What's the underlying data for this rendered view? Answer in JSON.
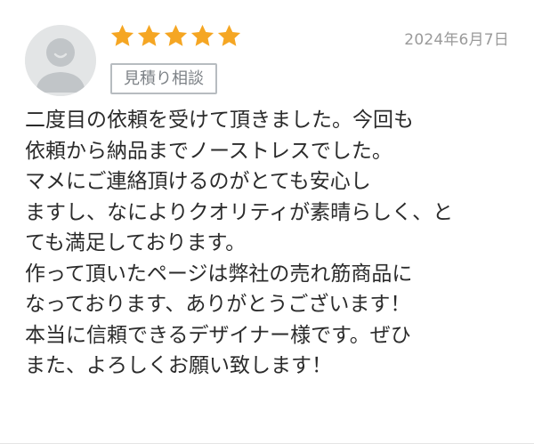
{
  "review": {
    "avatar_icon": "default-user-avatar-icon",
    "rating": {
      "value": 5,
      "max": 5,
      "icon": "star-icon",
      "color": "#f5a623"
    },
    "date": "2024年6月7日",
    "tag": "見積り相談",
    "body_lines": [
      "二度目の依頼を受けて頂きました。今回も",
      "依頼から納品までノーストレスでした。",
      "マメにご連絡頂けるのがとても安心しますし、なによりクオリティが素晴らしく、と",
      "ても満足しております。",
      "作って頂いたページは弊社の売れ筋商品に",
      "なっております、ありがとうございます！",
      "本当に信頼できるデザイナー様です。ぜひ",
      "また、よろしくお願い致します！"
    ]
  }
}
